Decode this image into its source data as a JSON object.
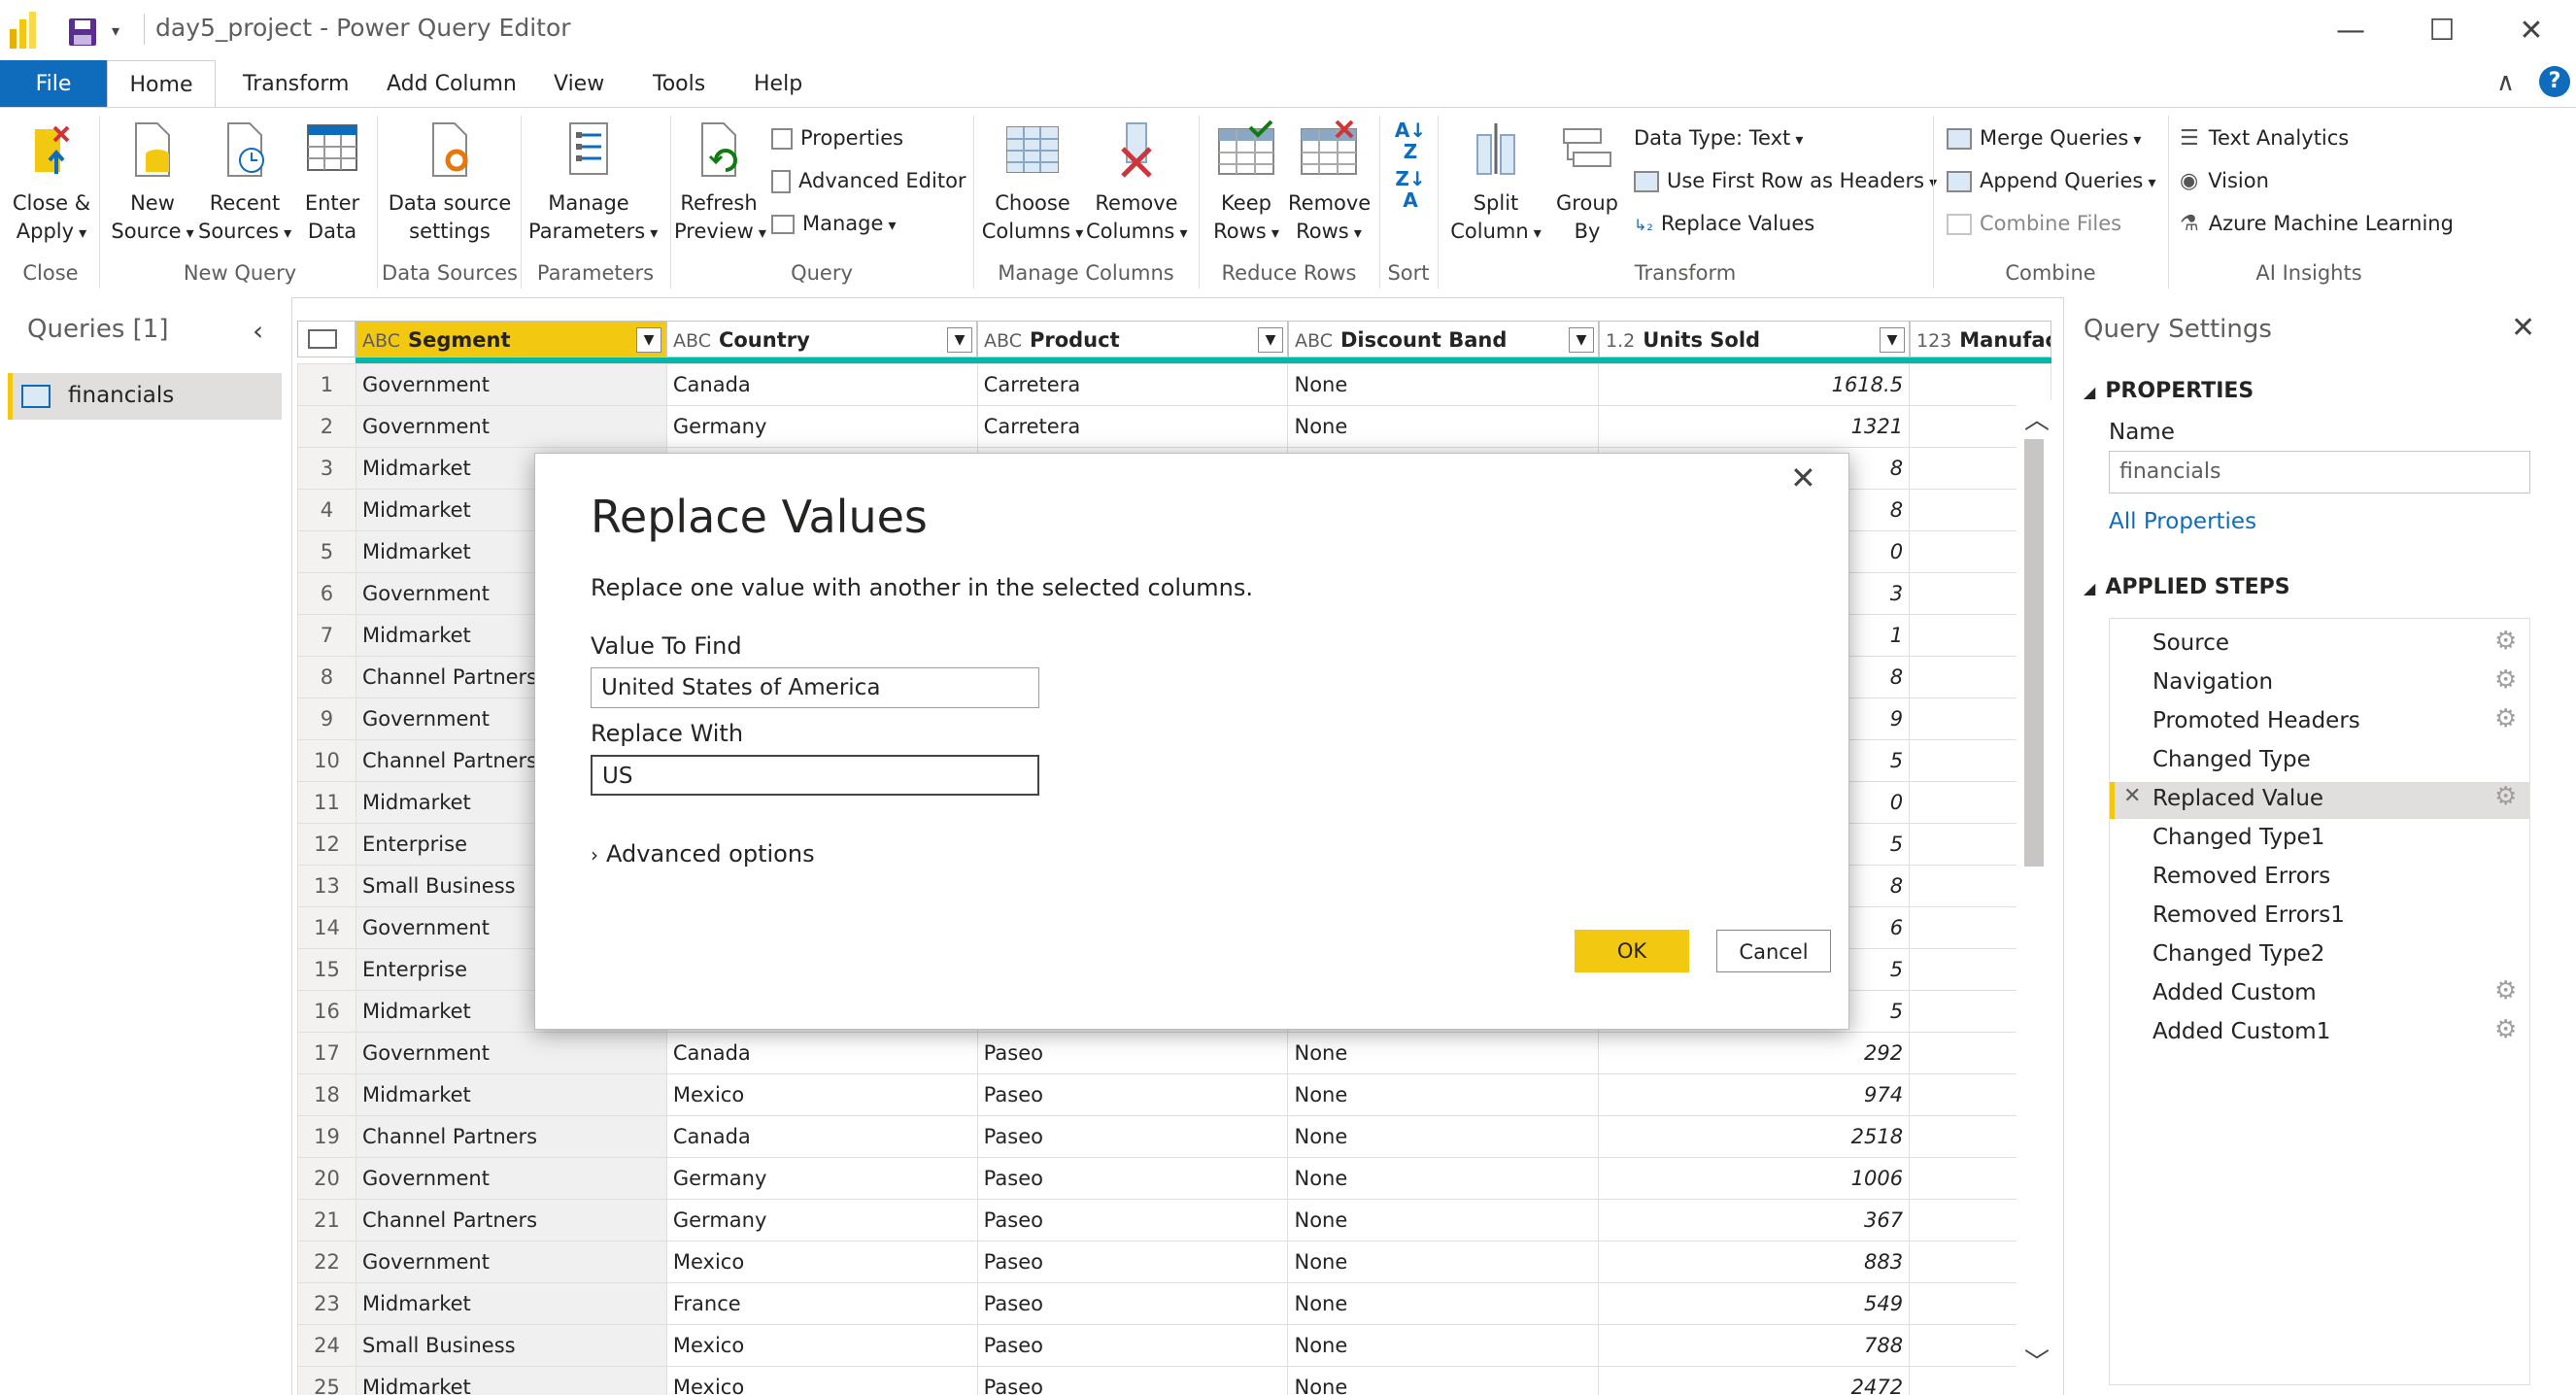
{
  "window": {
    "title": "day5_project - Power Query Editor",
    "minimize": "—",
    "maximize": "☐",
    "close": "✕"
  },
  "menu": {
    "tabs": [
      "File",
      "Home",
      "Transform",
      "Add Column",
      "View",
      "Tools",
      "Help"
    ],
    "active": "Home",
    "collapse_glyph": "∧",
    "help_glyph": "?"
  },
  "ribbon": {
    "close_apply": [
      "Close &",
      "Apply"
    ],
    "new_source": [
      "New",
      "Source"
    ],
    "recent_sources": [
      "Recent",
      "Sources"
    ],
    "enter_data": [
      "Enter",
      "Data"
    ],
    "data_source_settings": [
      "Data source",
      "settings"
    ],
    "manage_parameters": [
      "Manage",
      "Parameters"
    ],
    "refresh_preview": [
      "Refresh",
      "Preview"
    ],
    "properties": "Properties",
    "advanced_editor": "Advanced Editor",
    "manage": "Manage",
    "choose_columns": [
      "Choose",
      "Columns"
    ],
    "remove_columns": [
      "Remove",
      "Columns"
    ],
    "keep_rows": [
      "Keep",
      "Rows"
    ],
    "remove_rows": [
      "Remove",
      "Rows"
    ],
    "split_column": [
      "Split",
      "Column"
    ],
    "group_by": [
      "Group",
      "By"
    ],
    "data_type": "Data Type: Text",
    "use_first_row": "Use First Row as Headers",
    "replace_values": "Replace Values",
    "merge_queries": "Merge Queries",
    "append_queries": "Append Queries",
    "combine_files": "Combine Files",
    "text_analytics": "Text Analytics",
    "vision": "Vision",
    "azure_ml": "Azure Machine Learning",
    "groups": [
      "Close",
      "New Query",
      "Data Sources",
      "Parameters",
      "Query",
      "Manage Columns",
      "Reduce Rows",
      "Sort",
      "Transform",
      "Combine",
      "AI Insights"
    ]
  },
  "queries_pane": {
    "title": "Queries [1]",
    "items": [
      "financials"
    ]
  },
  "grid": {
    "columns": [
      {
        "type": "ABC",
        "name": "Segment"
      },
      {
        "type": "ABC",
        "name": "Country"
      },
      {
        "type": "ABC",
        "name": "Product"
      },
      {
        "type": "ABC",
        "name": "Discount Band"
      },
      {
        "type": "1.2",
        "name": "Units Sold"
      },
      {
        "type": "123",
        "name": "Manufact"
      }
    ],
    "rows": [
      [
        "1",
        "Government",
        "Canada",
        "Carretera",
        "None",
        "1618.5"
      ],
      [
        "2",
        "Government",
        "Germany",
        "Carretera",
        "None",
        "1321"
      ],
      [
        "3",
        "Midmarket",
        "",
        "",
        "",
        "8"
      ],
      [
        "4",
        "Midmarket",
        "",
        "",
        "",
        "8"
      ],
      [
        "5",
        "Midmarket",
        "",
        "",
        "",
        "0"
      ],
      [
        "6",
        "Government",
        "",
        "",
        "",
        "3"
      ],
      [
        "7",
        "Midmarket",
        "",
        "",
        "",
        "1"
      ],
      [
        "8",
        "Channel Partners",
        "",
        "",
        "",
        "8"
      ],
      [
        "9",
        "Government",
        "",
        "",
        "",
        "9"
      ],
      [
        "10",
        "Channel Partners",
        "",
        "",
        "",
        "5"
      ],
      [
        "11",
        "Midmarket",
        "",
        "",
        "",
        "0"
      ],
      [
        "12",
        "Enterprise",
        "",
        "",
        "",
        "5"
      ],
      [
        "13",
        "Small Business",
        "",
        "",
        "",
        "8"
      ],
      [
        "14",
        "Government",
        "",
        "",
        "",
        "6"
      ],
      [
        "15",
        "Enterprise",
        "",
        "",
        "",
        "5"
      ],
      [
        "16",
        "Midmarket",
        "",
        "",
        "",
        "5"
      ],
      [
        "17",
        "Government",
        "Canada",
        "Paseo",
        "None",
        "292"
      ],
      [
        "18",
        "Midmarket",
        "Mexico",
        "Paseo",
        "None",
        "974"
      ],
      [
        "19",
        "Channel Partners",
        "Canada",
        "Paseo",
        "None",
        "2518"
      ],
      [
        "20",
        "Government",
        "Germany",
        "Paseo",
        "None",
        "1006"
      ],
      [
        "21",
        "Channel Partners",
        "Germany",
        "Paseo",
        "None",
        "367"
      ],
      [
        "22",
        "Government",
        "Mexico",
        "Paseo",
        "None",
        "883"
      ],
      [
        "23",
        "Midmarket",
        "France",
        "Paseo",
        "None",
        "549"
      ],
      [
        "24",
        "Small Business",
        "Mexico",
        "Paseo",
        "None",
        "788"
      ],
      [
        "25",
        "Midmarket",
        "Mexico",
        "Paseo",
        "None",
        "2472"
      ]
    ]
  },
  "settings": {
    "title": "Query Settings",
    "properties_header": "PROPERTIES",
    "name_label": "Name",
    "name_value": "financials",
    "all_properties": "All Properties",
    "steps_header": "APPLIED STEPS",
    "steps": [
      {
        "label": "Source",
        "gear": true,
        "selected": false
      },
      {
        "label": "Navigation",
        "gear": true,
        "selected": false
      },
      {
        "label": "Promoted Headers",
        "gear": true,
        "selected": false
      },
      {
        "label": "Changed Type",
        "gear": false,
        "selected": false
      },
      {
        "label": "Replaced Value",
        "gear": true,
        "selected": true
      },
      {
        "label": "Changed Type1",
        "gear": false,
        "selected": false
      },
      {
        "label": "Removed Errors",
        "gear": false,
        "selected": false
      },
      {
        "label": "Removed Errors1",
        "gear": false,
        "selected": false
      },
      {
        "label": "Changed Type2",
        "gear": false,
        "selected": false
      },
      {
        "label": "Added Custom",
        "gear": true,
        "selected": false
      },
      {
        "label": "Added Custom1",
        "gear": true,
        "selected": false
      }
    ]
  },
  "dialog": {
    "title": "Replace Values",
    "description": "Replace one value with another in the selected columns.",
    "find_label": "Value To Find",
    "find_value": "United States of America",
    "replace_label": "Replace With",
    "replace_value": "US",
    "advanced": "Advanced options",
    "ok": "OK",
    "cancel": "Cancel"
  },
  "colors": {
    "accent_blue": "#0f6cbd",
    "selected_header": "#f2c811",
    "ok_button": "#f2c811",
    "teal_bar": "#01b8aa"
  }
}
